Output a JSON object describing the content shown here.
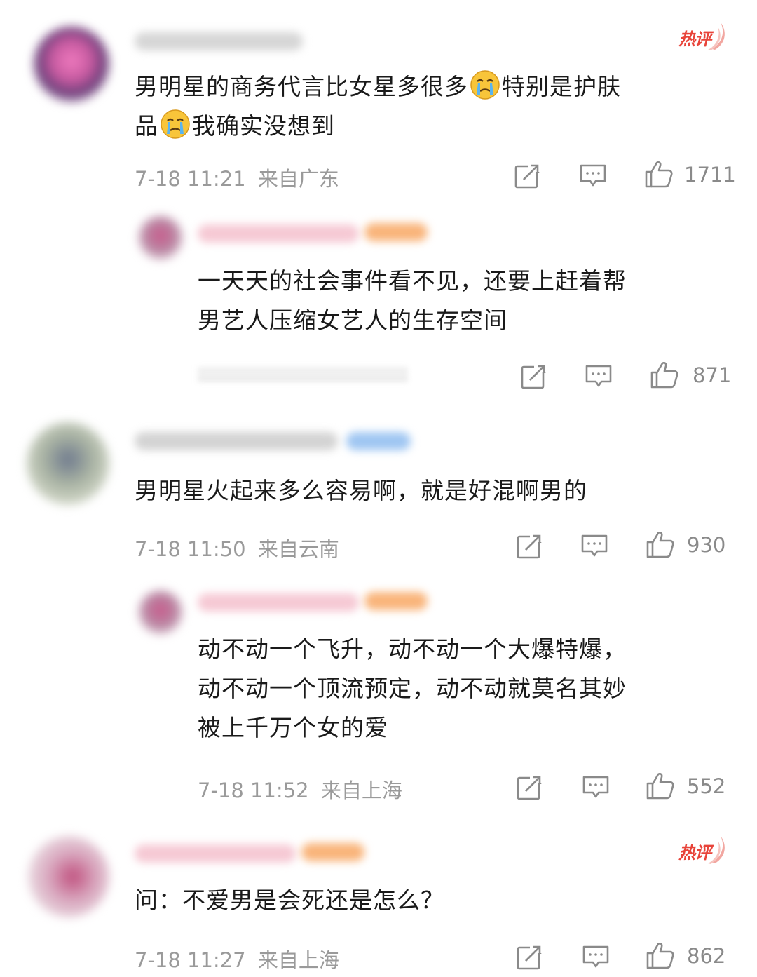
{
  "colors": {
    "hot_badge": "#e8443a",
    "meta": "#9a9a9a",
    "icon": "#8a8a8a"
  },
  "icons": {
    "share": "share-square-icon",
    "comment": "comment-bubble-icon",
    "like": "thumbs-up-icon",
    "emoji": "crying-face-emoji"
  },
  "comments": [
    {
      "hot_label": "热评",
      "text_line1a": "男明星的商务代言比女星多很多",
      "text_line1b": "特别是护肤",
      "text_line2a": "品",
      "text_line2b": "我确实没想到",
      "time": "7-18 11:21",
      "location": "来自广东",
      "likes": "1711"
    },
    {
      "text_line1": "一天天的社会事件看不见，还要上赶着帮",
      "text_line2": "男艺人压缩女艺人的生存空间",
      "likes": "871"
    },
    {
      "text_line1": "男明星火起来多么容易啊，就是好混啊男的",
      "time": "7-18 11:50",
      "location": "来自云南",
      "likes": "930"
    },
    {
      "text_line1": "动不动一个飞升，动不动一个大爆特爆，",
      "text_line2": "动不动一个顶流预定，动不动就莫名其妙",
      "text_line3": "被上千万个女的爱",
      "time": "7-18 11:52",
      "location": "来自上海",
      "likes": "552"
    },
    {
      "hot_label": "热评",
      "text_line1": "问：不爱男是会死还是怎么？",
      "time": "7-18 11:27",
      "location": "来自上海",
      "likes": "862"
    }
  ]
}
